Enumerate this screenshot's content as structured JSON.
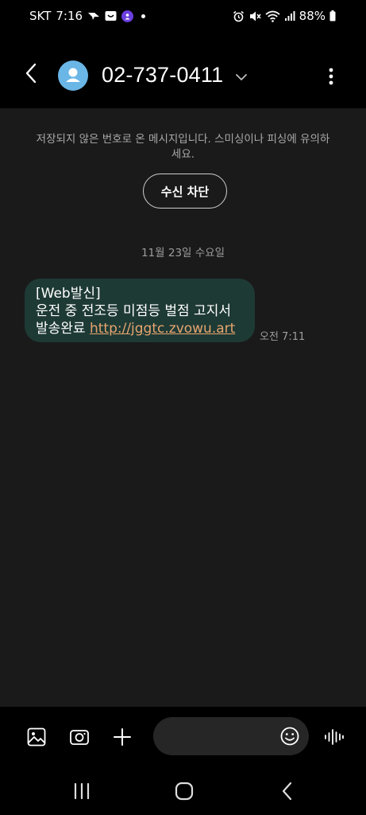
{
  "status_bar": {
    "carrier": "SKT",
    "time": "7:16",
    "battery": "88%"
  },
  "header": {
    "contact": "02-737-0411"
  },
  "chat": {
    "warning": "저장되지 않은 번호로 온 메시지입니다. 스미싱이나 피싱에 유의하세요.",
    "block_label": "수신 차단",
    "date": "11월 23일 수요일",
    "message": {
      "line1": "[Web발신]",
      "line2": "운전 중 전조등 미점등 벌점 고지서",
      "line3_prefix": "발송완료 ",
      "link": "http://jggtc.zvowu.art",
      "time": "오전 7:11"
    }
  },
  "composer": {
    "placeholder": ""
  },
  "colors": {
    "bubble": "#1e3a35",
    "link": "#e8a56f",
    "avatar": "#6ab6e6",
    "chat_bg": "#1a1a1a"
  },
  "icons": [
    "share-icon",
    "gallery-notification-icon",
    "app-notification-icon",
    "alarm-icon",
    "mute-icon",
    "wifi-icon",
    "signal-icon",
    "battery-icon",
    "back-icon",
    "person-icon",
    "chevron-down-icon",
    "more-vert-icon",
    "gallery-icon",
    "camera-icon",
    "plus-icon",
    "emoji-icon",
    "voice-icon",
    "recents-icon",
    "home-icon",
    "nav-back-icon"
  ]
}
